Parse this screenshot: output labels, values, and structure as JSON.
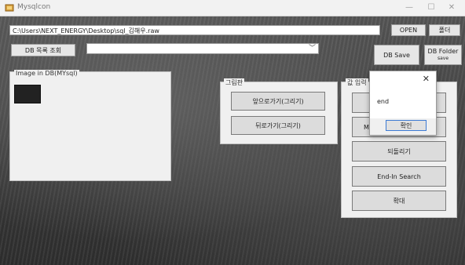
{
  "window": {
    "title": "Mysqlcon",
    "min_glyph": "—",
    "max_glyph": "☐",
    "close_glyph": "✕"
  },
  "path_field": {
    "value": "C:\\Users\\NEXT_ENERGY\\Desktop\\sql_김해우.raw"
  },
  "buttons": {
    "open": "OPEN",
    "folder": "폴더",
    "db_list": "DB 목록 조회",
    "db_save": "DB Save",
    "db_folder_line1": "DB Folder",
    "db_folder_line2": "save"
  },
  "image_group": {
    "label": "Image in DB(MYsql)"
  },
  "edit_group": {
    "label": "그림판",
    "forward": "앞으로가기(그리기)",
    "back": "뒤로가기(그리기)"
  },
  "right_group": {
    "label": "값 입력",
    "partial_m": "M",
    "revert": "되돌리기",
    "end_in_search": "End-In Search",
    "enlarge": "확대"
  },
  "dialog": {
    "message": "end",
    "ok": "확인",
    "close_glyph": "✕"
  },
  "colors": {
    "titlebar": "#f2f2f2",
    "panel": "#f0f0f0",
    "button": "#e6e6e6",
    "focus_border": "#3d7bd4"
  }
}
